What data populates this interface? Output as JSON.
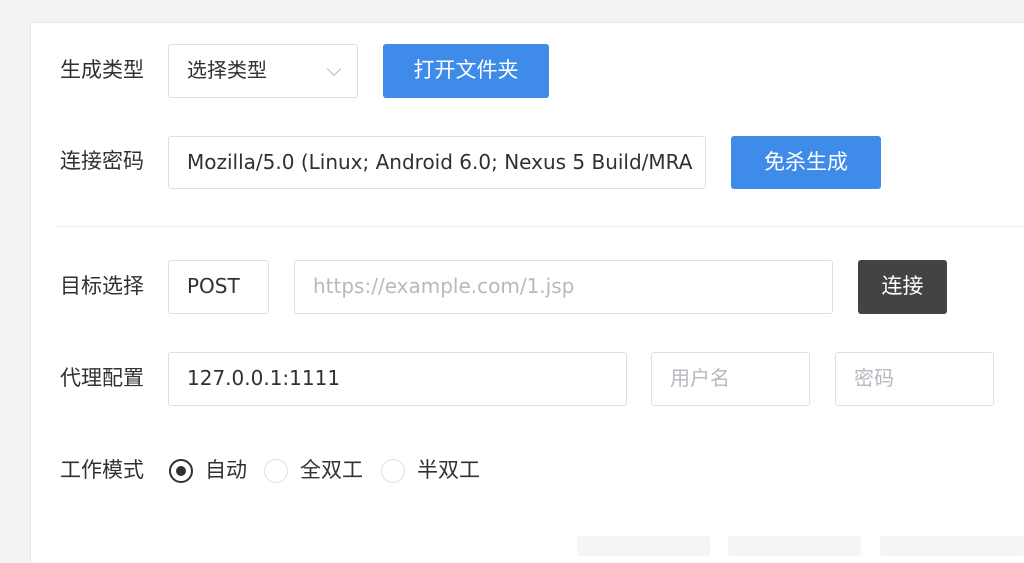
{
  "form": {
    "generate_type": {
      "label": "生成类型",
      "select_value": "选择类型",
      "open_folder_button": "打开文件夹"
    },
    "connect_password": {
      "label": "连接密码",
      "value": "Mozilla/5.0 (Linux; Android 6.0; Nexus 5 Build/MRA",
      "generate_button": "免杀生成"
    },
    "target": {
      "label": "目标选择",
      "method": "POST",
      "url_placeholder": "https://example.com/1.jsp",
      "connect_button": "连接"
    },
    "proxy": {
      "label": "代理配置",
      "address": "127.0.0.1:1111",
      "username_placeholder": "用户名",
      "password_placeholder": "密码"
    },
    "work_mode": {
      "label": "工作模式",
      "options": [
        {
          "label": "自动",
          "checked": true
        },
        {
          "label": "全双工",
          "checked": false
        },
        {
          "label": "半双工",
          "checked": false
        }
      ]
    }
  },
  "colors": {
    "primary": "#3e8bea",
    "dark_button": "#434343",
    "border": "#dcdfe6",
    "placeholder": "#b6b9bf"
  }
}
